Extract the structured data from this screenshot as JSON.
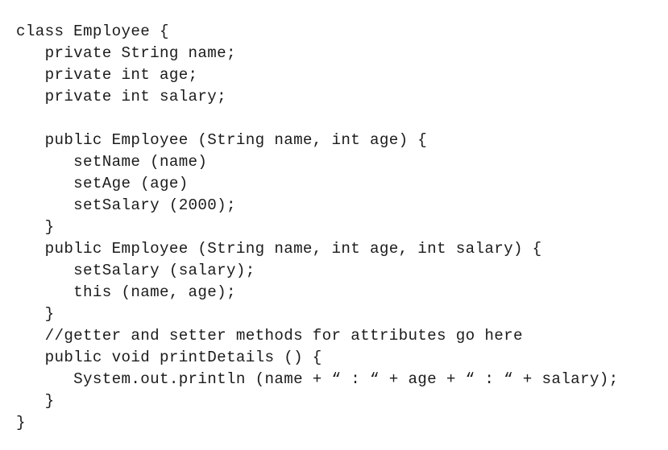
{
  "document": {
    "kind": "code-listing",
    "language": "Java",
    "background_color": "#ffffff",
    "text_color": "#1b1b1b",
    "lines": [
      "class Employee {",
      "   private String name;",
      "   private int age;",
      "   private int salary;",
      "",
      "   public Employee (String name, int age) {",
      "      setName (name)",
      "      setAge (age)",
      "      setSalary (2000);",
      "   }",
      "   public Employee (String name, int age, int salary) {",
      "      setSalary (salary);",
      "      this (name, age);",
      "   }",
      "   //getter and setter methods for attributes go here",
      "   public void printDetails () {",
      "      System.out.println (name + “ : “ + age + “ : “ + salary);",
      "   }",
      "}"
    ]
  }
}
